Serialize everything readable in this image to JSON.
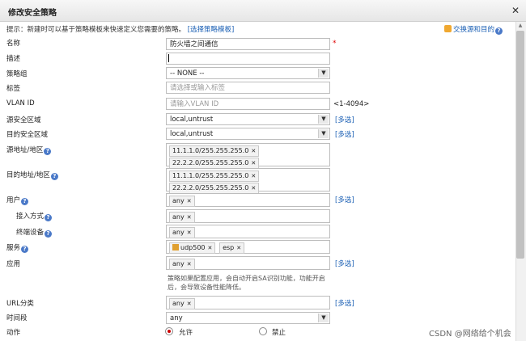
{
  "dialog": {
    "title": "修改安全策略",
    "close_symbol": "✕"
  },
  "hint": {
    "text": "提示：新建时可以基于策略模板来快速定义您需要的策略。",
    "link": "[选择策略模板]"
  },
  "swap_label": "交换源和目的",
  "help_symbol": "?",
  "required_mark": "*",
  "fields": {
    "name": {
      "label": "名称",
      "value": "防火墙之间通信"
    },
    "desc": {
      "label": "描述",
      "value": ""
    },
    "group": {
      "label": "策略组",
      "value": "-- NONE --"
    },
    "tag": {
      "label": "标签",
      "placeholder": "请选择或输入标签"
    },
    "vlan": {
      "label": "VLAN ID",
      "placeholder": "请输入VLAN ID",
      "range": "<1-4094>"
    },
    "src_zone": {
      "label": "源安全区域",
      "value": "local,untrust",
      "more": "[多选]"
    },
    "dst_zone": {
      "label": "目的安全区域",
      "value": "local,untrust",
      "more": "[多选]"
    },
    "src_addr": {
      "label": "源地址/地区",
      "tags": [
        "11.1.1.0/255.255.255.0",
        "22.2.2.0/255.255.255.0"
      ]
    },
    "dst_addr": {
      "label": "目的地址/地区",
      "tags": [
        "11.1.1.0/255.255.255.0",
        "22.2.2.0/255.255.255.0"
      ]
    },
    "user": {
      "label": "用户",
      "tags": [
        "any"
      ],
      "more": "[多选]"
    },
    "access": {
      "label": "接入方式",
      "tags": [
        "any"
      ]
    },
    "terminal": {
      "label": "终端设备",
      "tags": [
        "any"
      ]
    },
    "service": {
      "label": "服务",
      "tags": [
        "udp500",
        "esp"
      ]
    },
    "app": {
      "label": "应用",
      "tags": [
        "any"
      ],
      "more": "[多选]"
    },
    "app_note": "策略如果配置应用，会自动开启SA识别功能，功能开启后，会导致设备性能降低。",
    "url": {
      "label": "URL分类",
      "tags": [
        "any"
      ],
      "more": "[多选]"
    },
    "time": {
      "label": "时间段",
      "value": "any"
    },
    "action": {
      "label": "动作",
      "permit": "允许",
      "deny": "禁止",
      "selected": "permit"
    }
  },
  "watermark": "CSDN @网络给个机会"
}
